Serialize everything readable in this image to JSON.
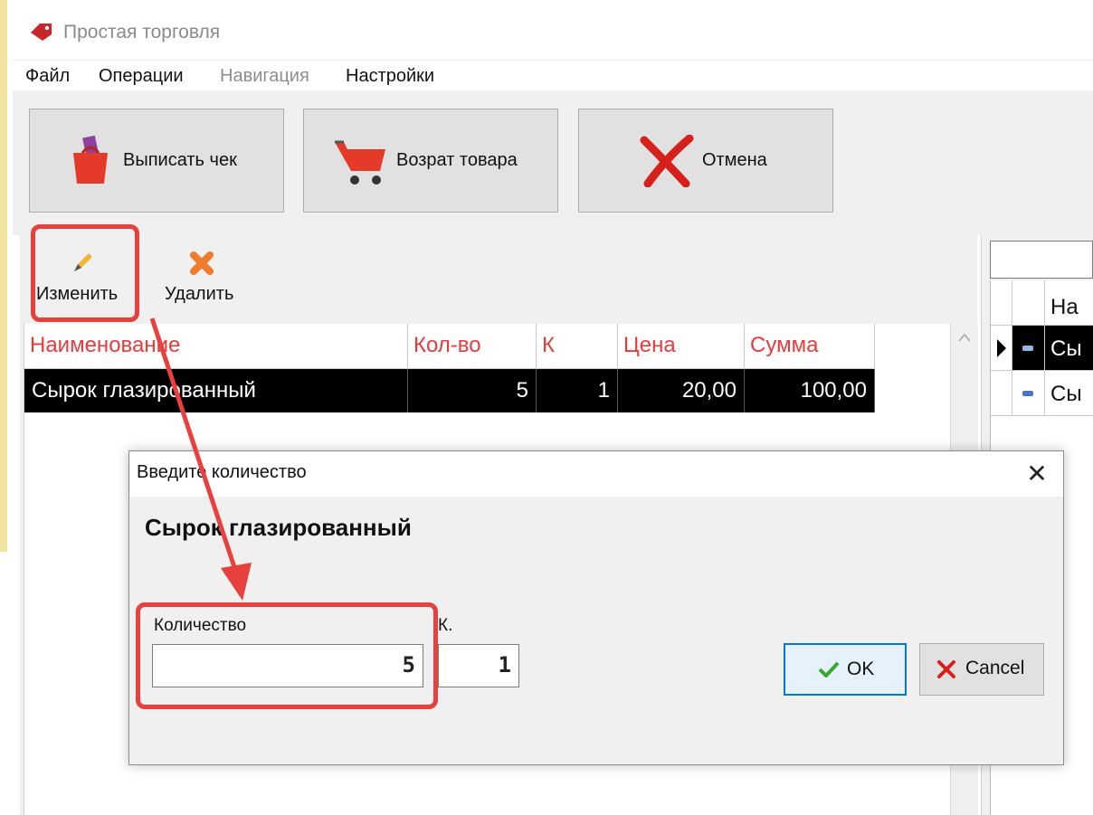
{
  "window": {
    "title": "Простая торговля"
  },
  "menu": [
    "Файл",
    "Операции",
    "Навигация",
    "Настройки"
  ],
  "toolbar": {
    "receipt": "Выписать чек",
    "return": "Возрат товара",
    "cancel": "Отмена"
  },
  "actions": {
    "edit": "Изменить",
    "delete": "Удалить"
  },
  "grid": {
    "headers": [
      "Наименование",
      "Кол-во",
      "К",
      "Цена",
      "Сумма"
    ],
    "rows": [
      {
        "name": "Сырок глазированный",
        "qty": "5",
        "k": "1",
        "price": "20,00",
        "sum": "100,00"
      }
    ]
  },
  "right_grid": {
    "header": "На",
    "rows": [
      "Сы",
      "Сы"
    ]
  },
  "dialog": {
    "title": "Введите количество",
    "product": "Сырок глазированный",
    "qty_label": "Количество",
    "qty_value": "5",
    "k_label": "К.",
    "k_value": "1",
    "ok": "OK",
    "cancel": "Cancel",
    "close": "✕"
  },
  "colors": {
    "header_text": "#e83b3b",
    "selected_row": "#000000",
    "highlight": "#e8413d",
    "ok_border": "#0078d7"
  }
}
